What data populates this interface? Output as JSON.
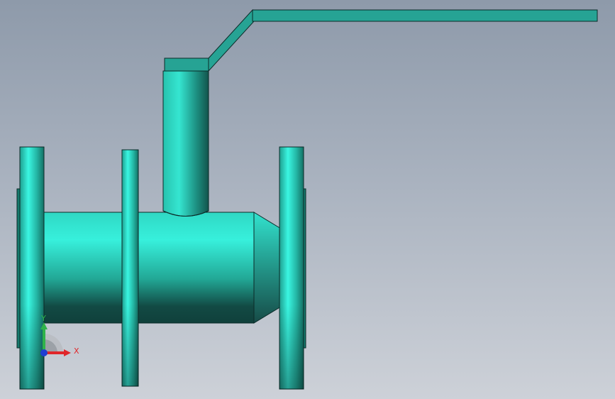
{
  "viewport": {
    "background_top": "#8e9aaa",
    "background_bottom": "#cdd1d8"
  },
  "model": {
    "name": "ball-valve",
    "body_color": "#2fd8c4",
    "edge_color": "#0b2b28"
  },
  "triad": {
    "x_label": "X",
    "y_label": "Y",
    "x_color": "#e0262a",
    "y_color": "#2fb34a",
    "z_color": "#1f3fd1"
  }
}
